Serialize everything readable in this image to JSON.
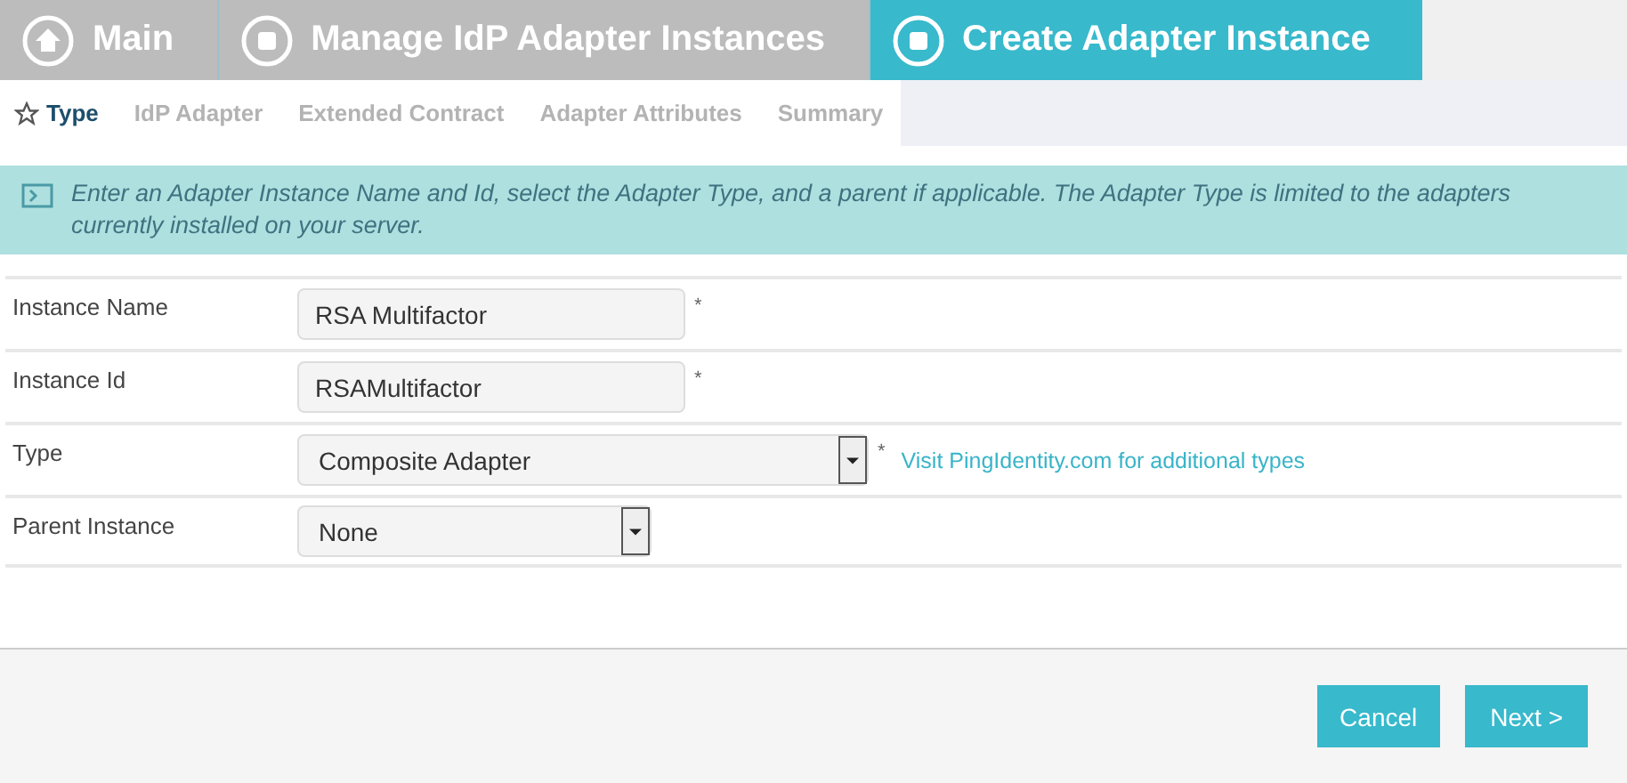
{
  "breadcrumbs": [
    {
      "kind": "home",
      "label": "Main",
      "selected": false
    },
    {
      "kind": "step",
      "label": "Manage IdP Adapter Instances",
      "selected": false
    },
    {
      "kind": "step",
      "label": "Create Adapter Instance",
      "selected": true
    }
  ],
  "tabs": [
    {
      "label": "Type",
      "selected": true
    },
    {
      "label": "IdP Adapter",
      "selected": false
    },
    {
      "label": "Extended Contract",
      "selected": false
    },
    {
      "label": "Adapter Attributes",
      "selected": false
    },
    {
      "label": "Summary",
      "selected": false
    }
  ],
  "info": "Enter an Adapter Instance Name and Id, select the Adapter Type, and a parent if applicable. The Adapter Type is limited to the adapters currently installed on your server.",
  "fields": [
    {
      "kind": "text",
      "label": "Instance Name",
      "value": "RSA Multifactor",
      "required_mark": "*"
    },
    {
      "kind": "text",
      "label": "Instance Id",
      "value": "RSAMultifactor",
      "required_mark": "*"
    },
    {
      "kind": "select",
      "label": "Type",
      "value": "Composite Adapter",
      "required_mark": "*",
      "wide": true,
      "link": "Visit PingIdentity.com for additional types"
    },
    {
      "kind": "select",
      "label": "Parent Instance",
      "value": "None",
      "wide": false
    }
  ],
  "buttons": [
    "Cancel",
    "Next >"
  ]
}
